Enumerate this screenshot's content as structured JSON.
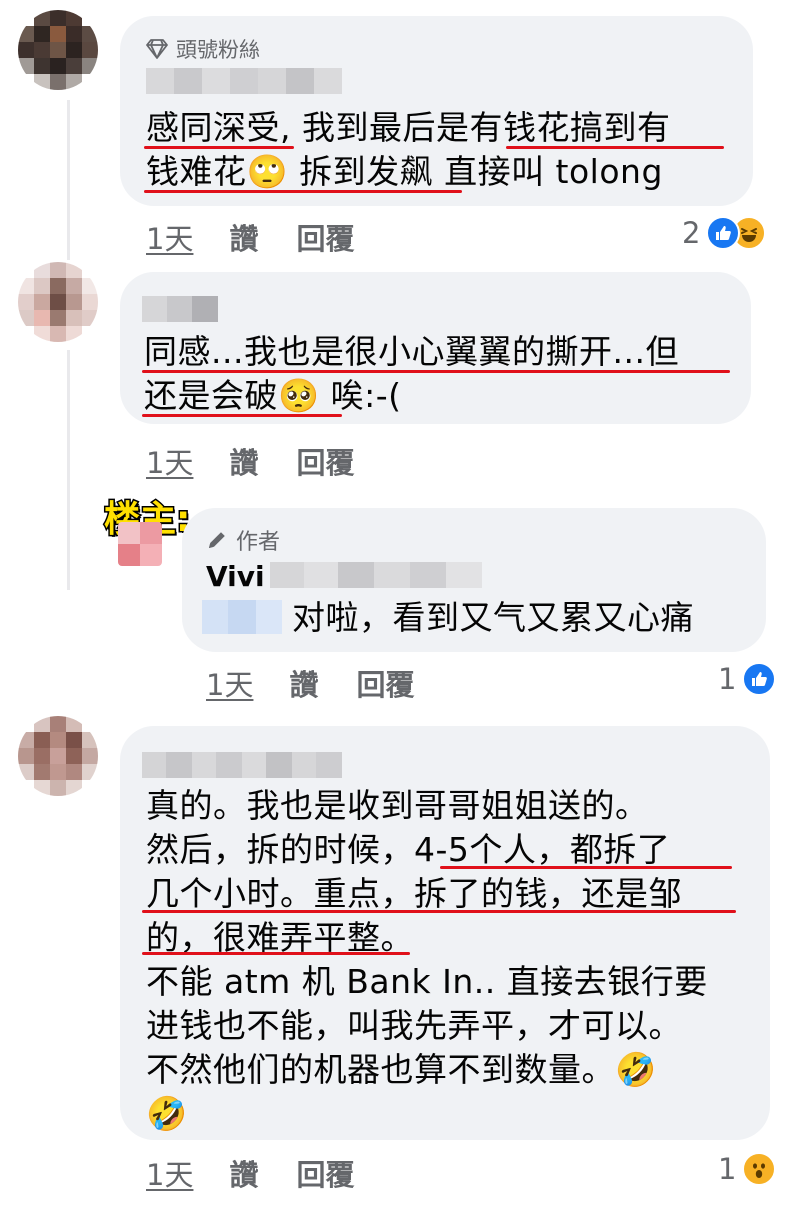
{
  "comments": [
    {
      "badge": "頭號粉絲",
      "lines": [
        "感同深受, 我到最后是有钱花搞到有",
        "钱难花🙄 拆到发飙  直接叫 tolong"
      ],
      "time": "1天",
      "like": "讚",
      "reply": "回覆",
      "reaction_count": "2",
      "reactions": [
        "like",
        "haha"
      ]
    },
    {
      "lines": [
        "同感...我也是很小心翼翼的撕开...但",
        "还是会破🥺 唉:-("
      ],
      "time": "1天",
      "like": "讚",
      "reply": "回覆"
    },
    {
      "op_tag": "楼主:",
      "badge": "作者",
      "name": "Vivi",
      "lines": [
        "对啦，看到又气又累又心痛"
      ],
      "time": "1天",
      "like": "讚",
      "reply": "回覆",
      "reaction_count": "1",
      "reactions": [
        "like"
      ]
    },
    {
      "lines": [
        "真的。我也是收到哥哥姐姐送的。",
        "然后，拆的时候，4-5个人，都拆了",
        "几个小时。重点，拆了的钱，还是邹",
        "的，很难弄平整。",
        "不能 atm 机 Bank In.. 直接去银行要",
        "进钱也不能，叫我先弄平，才可以。",
        "不然他们的机器也算不到数量。🤣",
        "🤣"
      ],
      "time": "1天",
      "like": "讚",
      "reply": "回覆",
      "reaction_count": "1",
      "reactions": [
        "wow"
      ]
    }
  ],
  "colors": {
    "bubble": "#f0f2f5",
    "meta_text": "#65676b",
    "underline": "#e0101a",
    "like_blue": "#1877f2",
    "reaction_yellow": "#f7b125"
  }
}
